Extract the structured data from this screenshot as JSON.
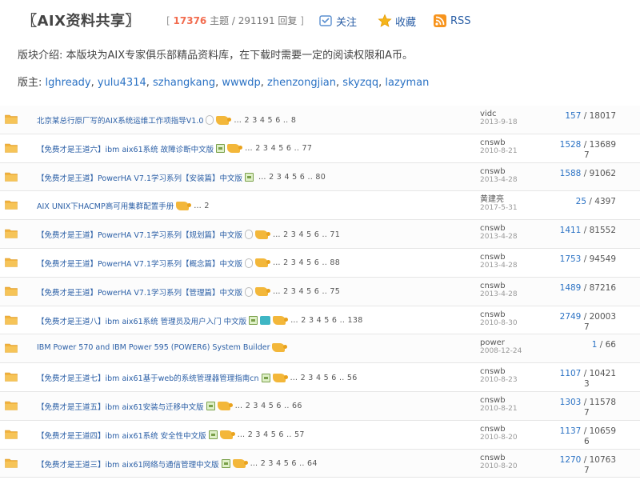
{
  "header": {
    "forum_title": "〖AIX资料共享〗",
    "stats_open": "[",
    "stats_threads": "17376",
    "stats_rest": " 主题 / 291191 回复",
    "stats_close": "]",
    "follow_label": "关注",
    "favorite_label": "收藏",
    "rss_label": "RSS"
  },
  "description": "版块介绍: 本版块为AIX专家俱乐部精品资料库，在下载时需要一定的阅读权限和A币。",
  "moderators": {
    "label": "版主:",
    "names": [
      "lghready",
      "yulu4314",
      "szhangkang",
      "wwwdp",
      "zhenzongjian",
      "skyzqq",
      "lazyman"
    ]
  },
  "threads": [
    {
      "title": "北京某总行原厂写的AIX系统运维工作项指导V1.0",
      "pages": "… 2 3 4 5 6 .. 8",
      "author": "vidc",
      "date": "2013-9-18",
      "replies": "157",
      "views": "18017",
      "views_tail": ""
    },
    {
      "title": "【免费才是王道六】ibm aix61系统 故障诊断中文版",
      "pages": "… 2 3 4 5 6 .. 77",
      "author": "cnswb",
      "date": "2010-8-21",
      "replies": "1528",
      "views": "13689",
      "views_tail": "7"
    },
    {
      "title": "【免费才是王道】PowerHA V7.1学习系列【安装篇】中文版",
      "pages": "… 2 3 4 5 6 .. 80",
      "author": "cnswb",
      "date": "2013-4-28",
      "replies": "1588",
      "views": "91062",
      "views_tail": ""
    },
    {
      "title": "AIX UNIX下HACMP高可用集群配置手册",
      "pages": "… 2",
      "author": "黄建亮",
      "date": "2017-5-31",
      "replies": "25",
      "views": "4397",
      "views_tail": ""
    },
    {
      "title": "【免费才是王道】PowerHA V7.1学习系列【规划篇】中文版",
      "pages": "… 2 3 4 5 6 .. 71",
      "author": "cnswb",
      "date": "2013-4-28",
      "replies": "1411",
      "views": "81552",
      "views_tail": ""
    },
    {
      "title": "【免费才是王道】PowerHA V7.1学习系列【概念篇】中文版",
      "pages": "… 2 3 4 5 6 .. 88",
      "author": "cnswb",
      "date": "2013-4-28",
      "replies": "1753",
      "views": "94549",
      "views_tail": ""
    },
    {
      "title": "【免费才是王道】PowerHA V7.1学习系列【管理篇】中文版",
      "pages": "… 2 3 4 5 6 .. 75",
      "author": "cnswb",
      "date": "2013-4-28",
      "replies": "1489",
      "views": "87216",
      "views_tail": ""
    },
    {
      "title": "【免费才是王道八】ibm aix61系统 管理员及用户入门 中文版",
      "pages": "… 2 3 4 5 6 .. 138",
      "author": "cnswb",
      "date": "2010-8-30",
      "replies": "2749",
      "views": "20003",
      "views_tail": "7"
    },
    {
      "title": "IBM Power 570 and IBM Power 595 (POWER6) System Builder",
      "pages": "",
      "author": "power",
      "date": "2008-12-24",
      "replies": "1",
      "views": "66",
      "views_tail": ""
    },
    {
      "title": "【免费才是王道七】ibm aix61基于web的系统管理器管理指南cn",
      "pages": "… 2 3 4 5 6 .. 56",
      "author": "cnswb",
      "date": "2010-8-23",
      "replies": "1107",
      "views": "10421",
      "views_tail": "3"
    },
    {
      "title": "【免费才是王道五】ibm aix61安装与迁移中文版",
      "pages": "… 2 3 4 5 6 .. 66",
      "author": "cnswb",
      "date": "2010-8-21",
      "replies": "1303",
      "views": "11578",
      "views_tail": "7"
    },
    {
      "title": "【免费才是王道四】ibm aix61系统 安全性中文版",
      "pages": "… 2 3 4 5 6 .. 57",
      "author": "cnswb",
      "date": "2010-8-20",
      "replies": "1137",
      "views": "10659",
      "views_tail": "6"
    },
    {
      "title": "【免费才是王道三】ibm aix61网络与通信管理中文版",
      "pages": "… 2 3 4 5 6 .. 64",
      "author": "cnswb",
      "date": "2010-8-20",
      "replies": "1270",
      "views": "10763",
      "views_tail": "7"
    }
  ],
  "icons": {
    "folder": "folder-icon",
    "follow": "follow-icon",
    "favorite": "star-icon",
    "rss": "rss-icon"
  },
  "colors": {
    "link": "#2b5fa6",
    "accent": "#f26c4f",
    "folder": "#f2b33d"
  }
}
